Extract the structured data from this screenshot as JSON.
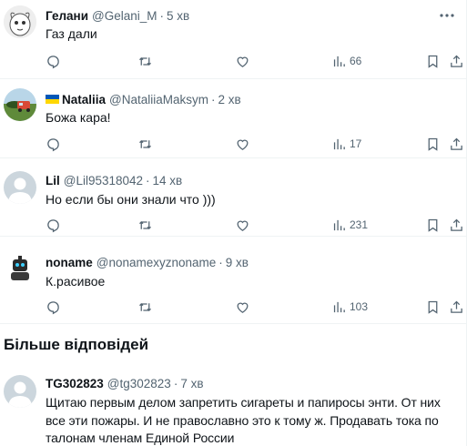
{
  "tweets": [
    {
      "name": "Гелани",
      "handle": "@Gelani_M",
      "time": "5 хв",
      "text": "Газ дали",
      "views": "66"
    },
    {
      "name": "Nataliia",
      "handle": "@NataliiaMaksym",
      "time": "2 хв",
      "text": "Божа кара!",
      "views": "17"
    },
    {
      "name": "Lil",
      "handle": "@Lil95318042",
      "time": "14 хв",
      "text": "Но если бы они знали что )))",
      "views": "231"
    },
    {
      "name": "noname",
      "handle": "@nonamexyznoname",
      "time": "9 хв",
      "text": "К.расивое",
      "views": "103"
    },
    {
      "name": "TG302823",
      "handle": "@tg302823",
      "time": "7 хв",
      "text": "Щитаю первым делом запретить сигареты и папиросы энти. От них все эти пожары. И не православно это к тому ж. Продавать тока по талонам членам  Единой России"
    }
  ],
  "more_replies_title": "Більше відповідей",
  "colors": {
    "text": "#0f1419",
    "secondary": "#536471",
    "divider": "#eff3f4",
    "flag_blue": "#0057b7",
    "flag_yellow": "#ffd700"
  },
  "icons": [
    "more-icon",
    "reply-icon",
    "retweet-icon",
    "like-icon",
    "views-icon",
    "bookmark-icon",
    "share-icon"
  ]
}
